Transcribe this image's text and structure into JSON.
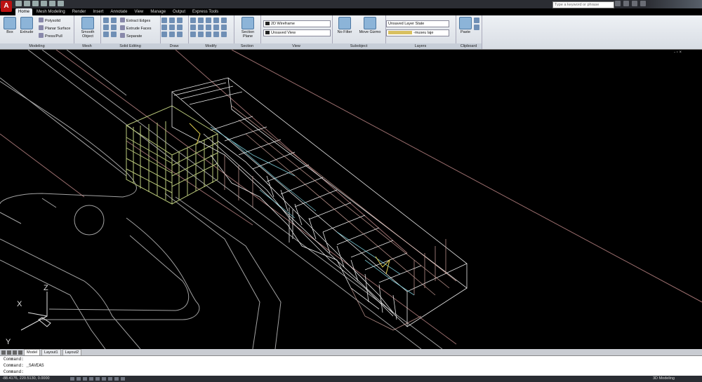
{
  "titlebar": {
    "search_placeholder": "Type a keyword or phrase"
  },
  "tabs": [
    "Home",
    "Mesh Modeling",
    "Render",
    "Insert",
    "Annotate",
    "View",
    "Manage",
    "Output",
    "Express Tools"
  ],
  "panels": {
    "modeling": {
      "title": "Modeling",
      "box": "Box",
      "extrude": "Extrude",
      "polysolid": "Polysolid",
      "planar": "Planar Surface",
      "presspull": "Press/Pull"
    },
    "mesh": {
      "title": "Mesh",
      "smooth": "Smooth Object"
    },
    "solid_editing": {
      "title": "Solid Editing",
      "extract": "Extract Edges",
      "extrude_faces": "Extrude Faces",
      "separate": "Separate"
    },
    "draw": {
      "title": "Draw"
    },
    "modify": {
      "title": "Modify"
    },
    "section": {
      "title": "Section",
      "plane": "Section Plane"
    },
    "view": {
      "title": "View",
      "visual_style": "2D Wireframe",
      "named_view": "Unsaved View"
    },
    "subobject": {
      "title": "Subobject",
      "filter": "No Filter",
      "gizmo": "Move Gizmo"
    },
    "layers": {
      "title": "Layers",
      "state": "Unsaved Layer State",
      "current": "-museu laje"
    },
    "clipboard": {
      "title": "Clipboard",
      "paste": "Paste"
    }
  },
  "viewport": {
    "controls": "- ▫ ×"
  },
  "ucs": {
    "x": "X",
    "y": "Y",
    "z": "Z"
  },
  "layout_tabs": [
    "Model",
    "Layout1",
    "Layout2"
  ],
  "command_lines": [
    "Command:",
    "Command:  _SAVEAS",
    "Command:"
  ],
  "status": {
    "coords": "-88.4176, 220.5130, 0.0000",
    "workspace": "3D Modeling"
  }
}
